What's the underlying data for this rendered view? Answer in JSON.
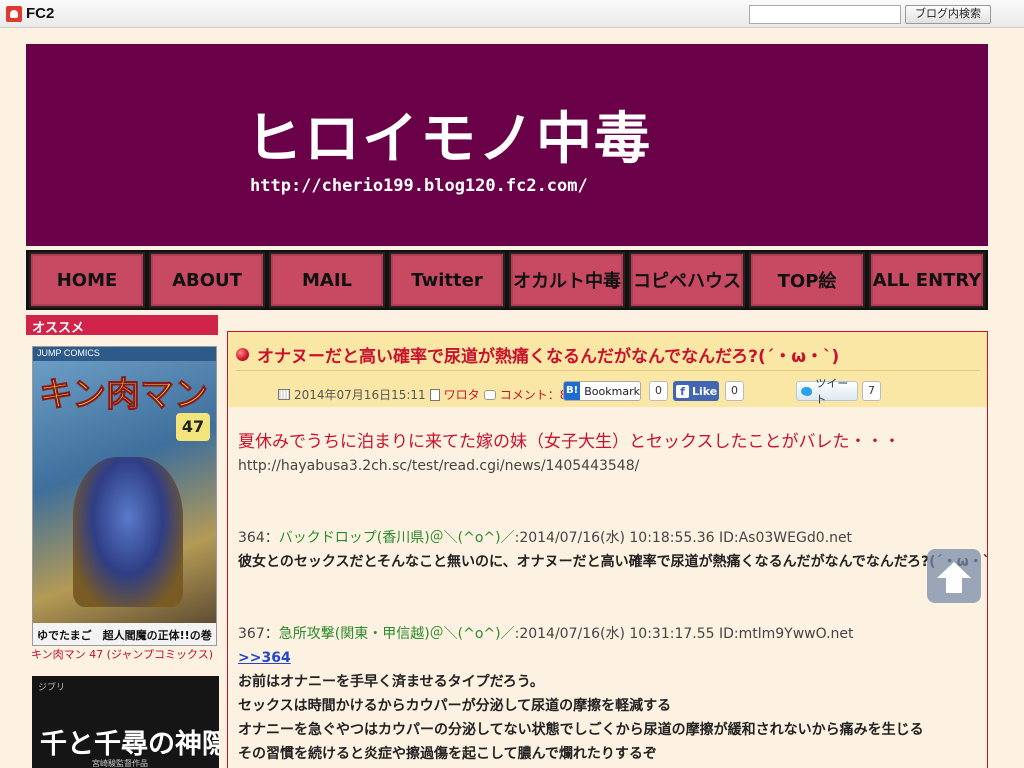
{
  "fc2bar": {
    "logo_text": "FC2",
    "search_placeholder": "",
    "search_button": "ブログ内検索"
  },
  "banner": {
    "title": "ヒロイモノ中毒",
    "url": "http://cherio199.blog120.fc2.com/",
    "bg_color": "#6a0048"
  },
  "nav": {
    "items": [
      {
        "label": "HOME"
      },
      {
        "label": "ABOUT"
      },
      {
        "label": "MAIL"
      },
      {
        "label": "Twitter"
      },
      {
        "label": "オカルト中毒"
      },
      {
        "label": "コピペハウス"
      },
      {
        "label": "TOP絵"
      },
      {
        "label": "ALL ENTRY"
      }
    ]
  },
  "sidebar": {
    "heading": "オススメ",
    "item1": {
      "cover_top": "JUMP COMICS",
      "cover_title": "キン肉マン",
      "cover_volume": "47",
      "cover_bottom": "ゆでたまご　超人閻魔の正体!!の巻",
      "caption": "キン肉マン 47 (ジャンプコミックス)"
    },
    "item2": {
      "cover_top": "ジブリ",
      "cover_title": "千と千尋の神隠し",
      "cover_sub": "宮崎駿監督作品"
    }
  },
  "post": {
    "title": "オナヌーだと高い確率で尿道が熱痛くなるんだがなんでなんだろ?(´・ω・`)",
    "date": "2014年07月16日15:11",
    "category": "ワロタ",
    "comments": "コメント：8",
    "share": {
      "hatena_label": "Bookmark",
      "hatena_count": "0",
      "fb_label": "Like",
      "fb_count": "0",
      "tweet_label": "ツイート",
      "tweet_count": "7"
    },
    "headline": "夏休みでうちに泊まりに来てた嫁の妹（女子大生）とセックスしたことがバレた・・・",
    "source_url": "http://hayabusa3.2ch.sc/test/read.cgi/news/1405443548/",
    "res1": {
      "num": "364：",
      "name": "バックドロップ(香川県)＠＼(^o^)／",
      "info": ":2014/07/16(水) 10:18:55.36 ID:As03WEGd0.net",
      "text": "彼女とのセックスだとそんなこと無いのに、オナヌーだと高い確率で尿道が熱痛くなるんだがなんでなんだろ?(´・ω・`)"
    },
    "res2": {
      "num": "367：",
      "name": "急所攻撃(関東・甲信越)＠＼(^o^)／",
      "info": ":2014/07/16(水) 10:31:17.55 ID:mtlm9YwwO.net",
      "anchor": ">>364",
      "lines": [
        "お前はオナニーを手早く済ませるタイプだろう。",
        "セックスは時間かけるからカウパーが分泌して尿道の摩擦を軽減する",
        "オナニーを急ぐやつはカウパーの分泌してない状態でしごくから尿道の摩擦が緩和されないから痛みを生じる",
        "その習慣を続けると炎症や擦過傷を起こして膿んで爛れたりするぞ"
      ]
    }
  },
  "colors": {
    "accent": "#c9132e",
    "nav_button": "#c74a62",
    "post_header": "#fae7a5",
    "page_bg": "#fdf2e1"
  }
}
